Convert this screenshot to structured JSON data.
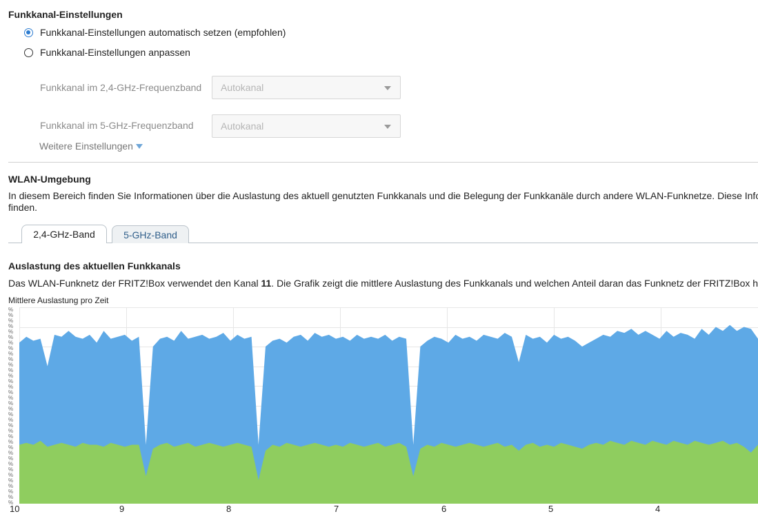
{
  "settings": {
    "title": "Funkkanal-Einstellungen",
    "radio_auto": "Funkkanal-Einstellungen automatisch setzen (empfohlen)",
    "radio_custom": "Funkkanal-Einstellungen anpassen",
    "band24_label": "Funkkanal im 2,4-GHz-Frequenzband",
    "band24_value": "Autokanal",
    "band5_label": "Funkkanal im 5-GHz-Frequenzband",
    "band5_value": "Autokanal",
    "more_link": "Weitere Einstellungen",
    "selected": "auto"
  },
  "environment": {
    "title": "WLAN-Umgebung",
    "desc_line1": "In diesem Bereich finden Sie Informationen über die Auslastung des aktuell genutzten Funkkanals und die Belegung der Funkkanäle durch andere WLAN-Funknetze. Diese Inform",
    "desc_line2": "finden.",
    "tabs": [
      {
        "label": "2,4-GHz-Band",
        "active": true
      },
      {
        "label": "5-GHz-Band",
        "active": false
      }
    ]
  },
  "usage": {
    "title": "Auslastung des aktuellen Funkkanals",
    "desc_pre": "Das WLAN-Funknetz der FRITZ!Box verwendet den Kanal ",
    "channel": "11",
    "desc_post": ". Die Grafik zeigt die mittlere Auslastung des Funkkanals und welchen Anteil daran das Funknetz der FRITZ!Box hat.",
    "chart_caption": "Mittlere Auslastung pro Zeit",
    "y_tick_label": "%",
    "colors": {
      "total": "#5ea9e6",
      "own": "#8fcd5f",
      "grid": "#e6e6e6"
    }
  },
  "chart_data": {
    "type": "area",
    "title": "Mittlere Auslastung pro Zeit",
    "xlabel": "",
    "ylabel": "",
    "x_ticks": [
      "10",
      "9",
      "8",
      "7",
      "6",
      "5",
      "4"
    ],
    "ylim": [
      0,
      100
    ],
    "grid": true,
    "series": [
      {
        "values": [
          82,
          85,
          83,
          84,
          70,
          86,
          85,
          88,
          85,
          84,
          86,
          82,
          88,
          84,
          85,
          86,
          83,
          85,
          30,
          80,
          84,
          85,
          83,
          88,
          84,
          85,
          86,
          84,
          85,
          87,
          83,
          86,
          84,
          85,
          30,
          80,
          83,
          84,
          82,
          85,
          86,
          83,
          87,
          85,
          86,
          84,
          85,
          83,
          86,
          84,
          85,
          84,
          86,
          83,
          85,
          84,
          30,
          80,
          83,
          85,
          84,
          82,
          86,
          84,
          85,
          83,
          86,
          85,
          84,
          87,
          85,
          72,
          86,
          84,
          85,
          82,
          86,
          84,
          85,
          83,
          80,
          82,
          84,
          86,
          85,
          88,
          87,
          89,
          86,
          88,
          86,
          84,
          88,
          85,
          87,
          86,
          84,
          89,
          86,
          90,
          88,
          91,
          88,
          90,
          89,
          84
        ]
      },
      {
        "values": [
          30,
          31,
          30,
          32,
          29,
          30,
          31,
          30,
          29,
          31,
          30,
          30,
          29,
          31,
          30,
          29,
          30,
          30,
          14,
          28,
          30,
          31,
          29,
          30,
          31,
          29,
          30,
          31,
          30,
          29,
          30,
          31,
          30,
          29,
          12,
          27,
          30,
          29,
          31,
          30,
          29,
          30,
          31,
          30,
          29,
          30,
          29,
          31,
          30,
          29,
          30,
          31,
          29,
          30,
          31,
          29,
          14,
          28,
          30,
          29,
          31,
          30,
          29,
          30,
          31,
          30,
          29,
          30,
          31,
          29,
          30,
          27,
          30,
          31,
          29,
          30,
          29,
          31,
          30,
          29,
          28,
          30,
          31,
          30,
          32,
          31,
          30,
          32,
          31,
          30,
          32,
          31,
          30,
          32,
          31,
          30,
          32,
          31,
          30,
          31,
          32,
          30,
          31,
          29,
          26,
          30
        ]
      }
    ]
  }
}
